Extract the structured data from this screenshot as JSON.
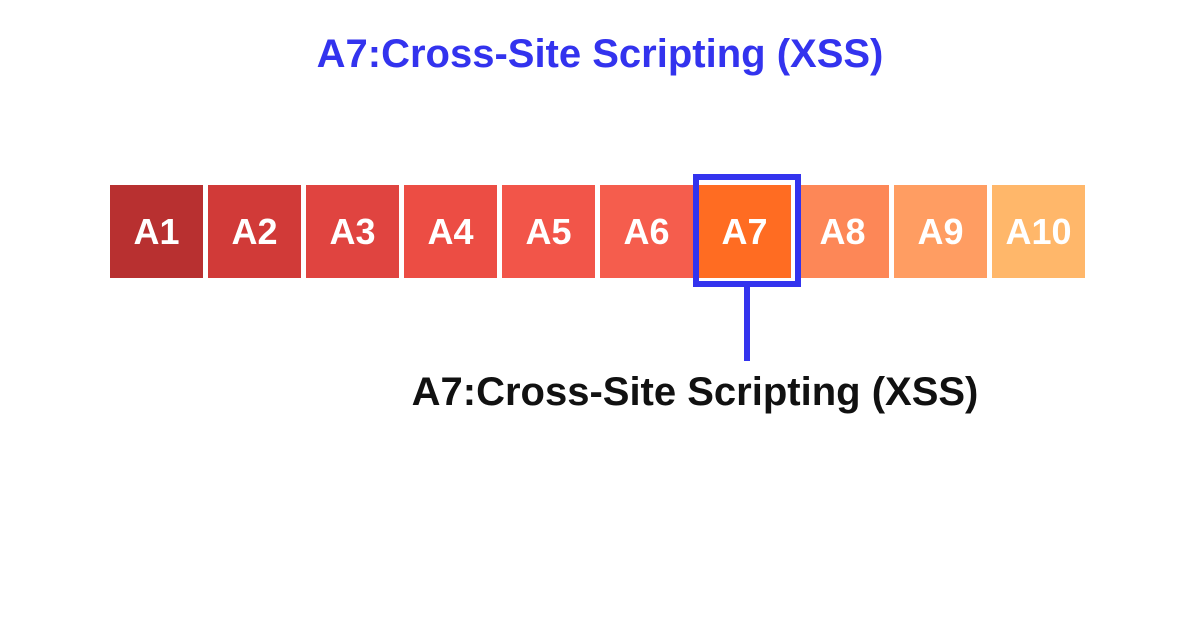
{
  "title": "A7:Cross-Site Scripting (XSS)",
  "subtitle": "A7:Cross-Site Scripting (XSS)",
  "boxes": [
    {
      "label": "A1",
      "color": "#b83030"
    },
    {
      "label": "A2",
      "color": "#d13a38"
    },
    {
      "label": "A3",
      "color": "#e04440"
    },
    {
      "label": "A4",
      "color": "#ec4d44"
    },
    {
      "label": "A5",
      "color": "#f25549"
    },
    {
      "label": "A6",
      "color": "#f55d4d"
    },
    {
      "label": "A7",
      "color": "#ff6c22"
    },
    {
      "label": "A8",
      "color": "#fd8757"
    },
    {
      "label": "A9",
      "color": "#ff9d62"
    },
    {
      "label": "A10",
      "color": "#ffb76a"
    }
  ],
  "highlight_index": 6,
  "accent_color": "#3333ee"
}
